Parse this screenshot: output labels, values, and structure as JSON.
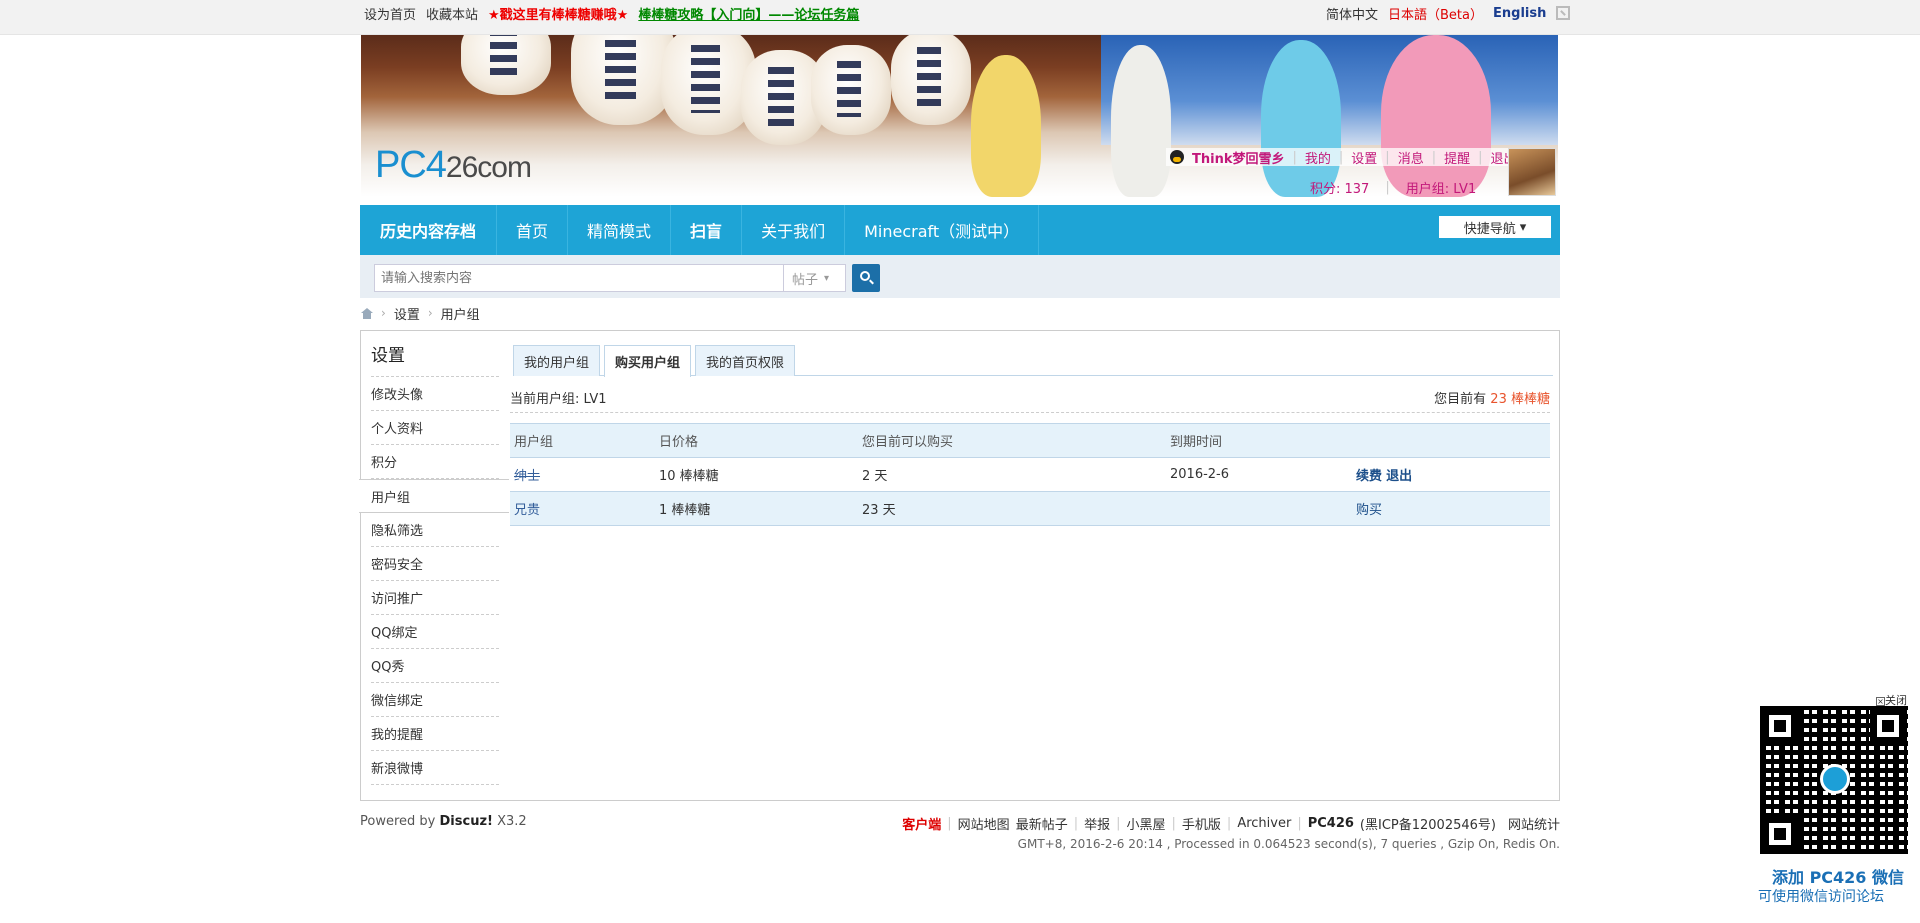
{
  "topbar": {
    "set_home": "设为首页",
    "bookmark": "收藏本站",
    "promo": "★戳这里有棒棒糖赚哦★",
    "guide": "棒棒糖攻略【入门向】——论坛任务篇",
    "lang_cn": "简体中文",
    "lang_jp": "日本語（Beta）",
    "lang_en": "English"
  },
  "banner": {
    "logo_main": "PC4",
    "logo_tail": "26com"
  },
  "user": {
    "name": "Think梦回雪乡",
    "links": [
      "我的",
      "设置",
      "消息",
      "提醒",
      "退出"
    ],
    "points": "积分: 137",
    "group": "用户组: LV1"
  },
  "nav": {
    "items": [
      "历史内容存档",
      "首页",
      "精简模式",
      "扫盲",
      "关于我们",
      "Minecraft（测试中）"
    ],
    "quick_nav": "快捷导航"
  },
  "search": {
    "placeholder": "请输入搜索内容",
    "type": "帖子"
  },
  "breadcrumb": {
    "items": [
      "设置",
      "用户组"
    ]
  },
  "sidebar": {
    "title": "设置",
    "items": [
      "修改头像",
      "个人资料",
      "积分",
      "用户组",
      "隐私筛选",
      "密码安全",
      "访问推广",
      "QQ绑定",
      "QQ秀",
      "微信绑定",
      "我的提醒",
      "新浪微博"
    ]
  },
  "tabs": [
    "我的用户组",
    "购买用户组",
    "我的首页权限"
  ],
  "current": {
    "label": "当前用户组: LV1",
    "have_prefix": "您目前有",
    "have_num": "23",
    "have_unit": "棒棒糖"
  },
  "table": {
    "headers": [
      "用户组",
      "日价格",
      "您目前可以购买",
      "到期时间",
      ""
    ],
    "rows": [
      {
        "group": "绅士",
        "price": "10 棒棒糖",
        "can_buy": "2 天",
        "expire": "2016-2-6",
        "action1": "续费",
        "action2": "退出"
      },
      {
        "group": "兄贵",
        "price": "1 棒棒糖",
        "can_buy": "23 天",
        "expire": "",
        "action1": "购买",
        "action2": ""
      }
    ]
  },
  "footer": {
    "powered_prefix": "Powered by",
    "powered_brand": "Discuz!",
    "powered_ver": "X3.2",
    "links": [
      "客户端",
      "网站地图",
      "最新帖子",
      "举报",
      "小黑屋",
      "手机版",
      "Archiver"
    ],
    "site": "PC426",
    "icp": "(黑ICP备12002546号)",
    "stats_link": "网站统计",
    "stats": "GMT+8, 2016-2-6 20:14 , Processed in 0.064523 second(s), 7 queries , Gzip On, Redis On."
  },
  "qr": {
    "close": "关闭",
    "line1": "添加 PC426 微信",
    "line2": "可使用微信访问论坛"
  },
  "colors": {
    "nav": "#1ea4d6",
    "accent_pink": "#c2187a",
    "link_blue": "#335e9a"
  }
}
